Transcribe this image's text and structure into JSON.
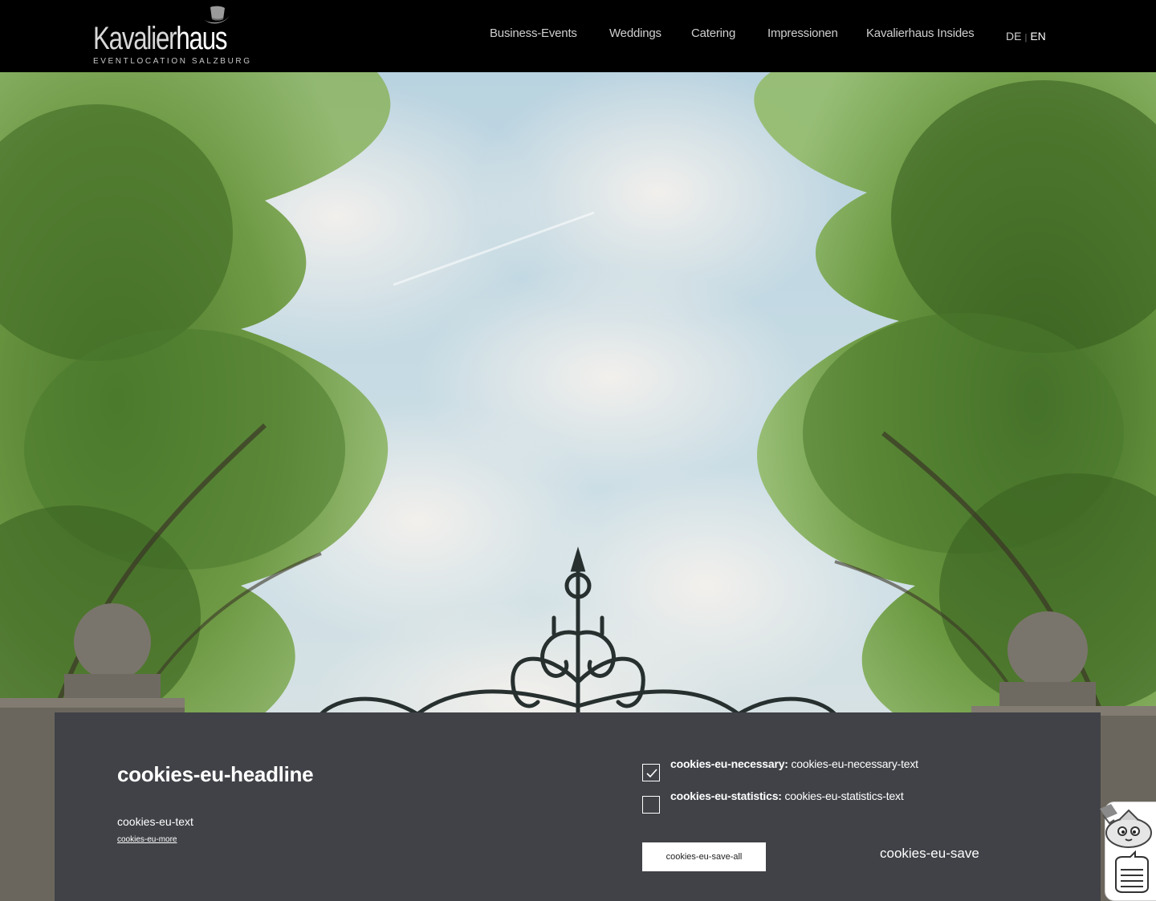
{
  "header": {
    "logo": {
      "word_light": "Kavalier",
      "word_bold": "haus",
      "tagline": "EVENTLOCATION SALZBURG"
    },
    "nav": [
      {
        "label": "Business-Events"
      },
      {
        "label": "Weddings"
      },
      {
        "label": "Catering"
      },
      {
        "label": "Impressionen"
      },
      {
        "label": "Kavalierhaus Insides"
      }
    ],
    "lang": {
      "de": "DE",
      "separator": "|",
      "en": "EN",
      "active": "EN"
    }
  },
  "hero": {
    "icons": [
      "tree-foliage",
      "wrought-iron-gate",
      "stone-pillar"
    ]
  },
  "cookie_banner": {
    "headline": "cookies-eu-headline",
    "text": "cookies-eu-text",
    "more_link": "cookies-eu-more",
    "options": [
      {
        "label": "cookies-eu-necessary:",
        "text": "cookies-eu-necessary-text",
        "checked": true
      },
      {
        "label": "cookies-eu-statistics:",
        "text": "cookies-eu-statistics-text",
        "checked": false
      }
    ],
    "save_all": "cookies-eu-save-all",
    "save": "cookies-eu-save"
  },
  "chat_widget": {
    "icons": [
      "mascot-icon",
      "chat-list-icon"
    ]
  },
  "colors": {
    "header_bg": "#000000",
    "banner_bg": "#404247",
    "sky": "#c7dbe4",
    "foliage": "#5f8a3a"
  }
}
